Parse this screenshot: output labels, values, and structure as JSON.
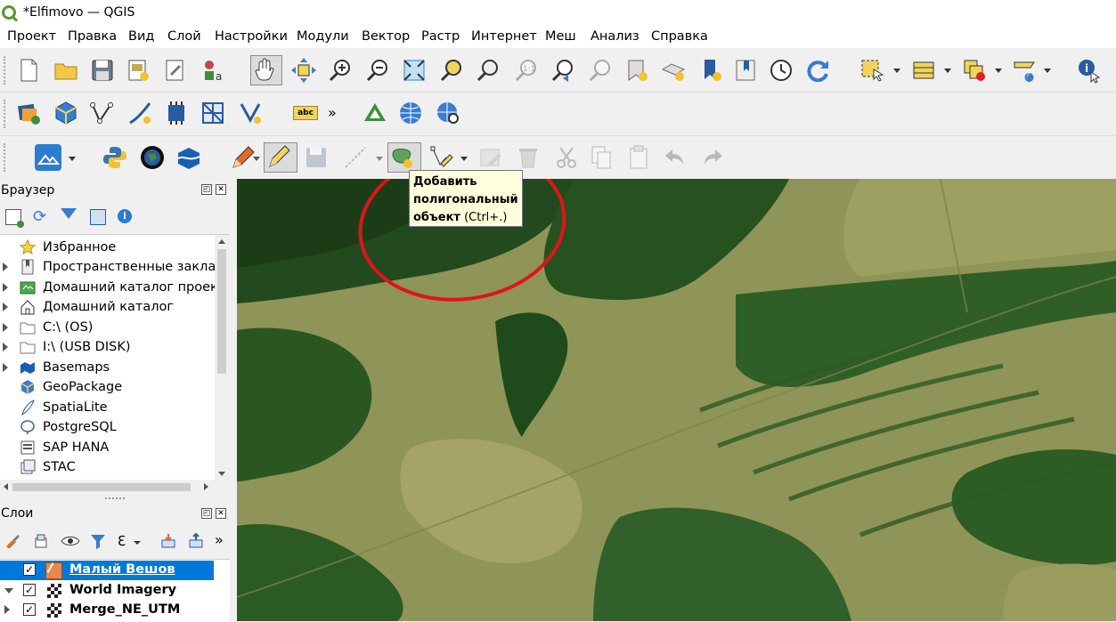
{
  "window": {
    "title": "*Elfimovo — QGIS"
  },
  "menu": [
    "Проект",
    "Правка",
    "Вид",
    "Слой",
    "Настройки",
    "Модули",
    "Вектор",
    "Растр",
    "Интернет",
    "Меш",
    "Анализ",
    "Справка"
  ],
  "browser_panel": {
    "title": "Браузер",
    "items": [
      {
        "label": "Избранное",
        "icon": "star-icon",
        "expandable": false
      },
      {
        "label": "Пространственные закладки",
        "icon": "bookmark-icon",
        "expandable": true
      },
      {
        "label": "Домашний каталог проекта",
        "icon": "project-home-icon",
        "expandable": true
      },
      {
        "label": "Домашний каталог",
        "icon": "home-icon",
        "expandable": true
      },
      {
        "label": "C:\\ (OS)",
        "icon": "folder-icon",
        "expandable": true
      },
      {
        "label": "I:\\ (USB DISK)",
        "icon": "folder-icon",
        "expandable": true
      },
      {
        "label": "Basemaps",
        "icon": "basemaps-icon",
        "expandable": true
      },
      {
        "label": "GeoPackage",
        "icon": "geopackage-icon",
        "expandable": false
      },
      {
        "label": "SpatiaLite",
        "icon": "spatialite-icon",
        "expandable": false
      },
      {
        "label": "PostgreSQL",
        "icon": "postgresql-icon",
        "expandable": false
      },
      {
        "label": "SAP HANA",
        "icon": "sap-hana-icon",
        "expandable": false
      },
      {
        "label": "STAC",
        "icon": "stac-icon",
        "expandable": false
      }
    ]
  },
  "layers_panel": {
    "title": "Слои",
    "layers": [
      {
        "name": "Малый Вешов",
        "checked": true,
        "selected": true,
        "icon": "polygon-layer-icon"
      },
      {
        "name": "World Imagery",
        "checked": true,
        "selected": false,
        "icon": "raster-layer-icon"
      },
      {
        "name": "Merge_NE_UTM",
        "checked": true,
        "selected": false,
        "icon": "raster-layer-icon"
      }
    ]
  },
  "tooltip": {
    "title": "Добавить полигональный объект",
    "shortcut": "(Ctrl+.)"
  },
  "toolbar": {
    "label_button": "abc",
    "overflow": "»"
  },
  "colors": {
    "selection": "#0078d7",
    "tooltip_bg": "#ffffdc",
    "annotation_circle": "#e0141c"
  }
}
